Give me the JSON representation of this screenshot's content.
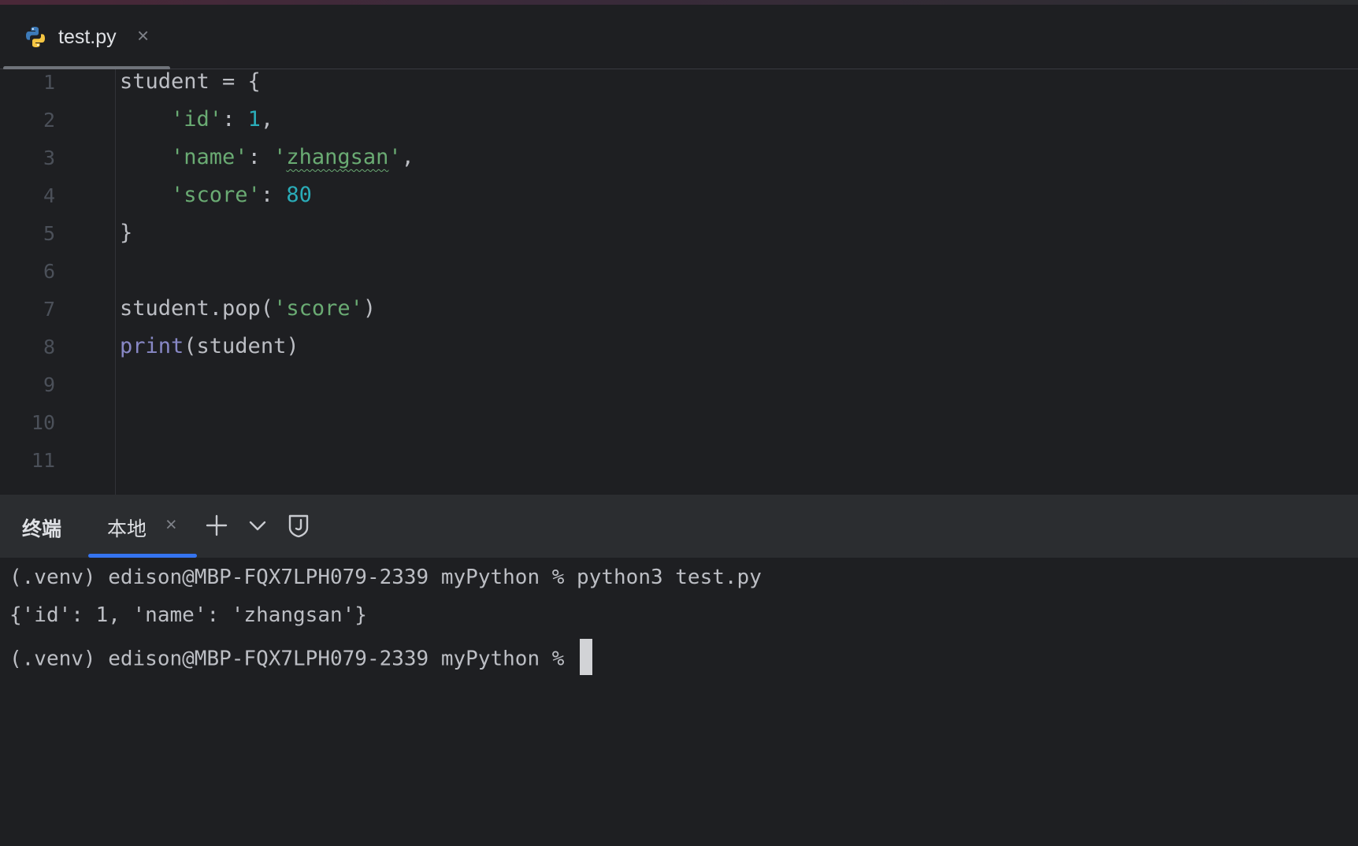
{
  "tab": {
    "filename": "test.py",
    "close": "×"
  },
  "editor": {
    "line_numbers": [
      "1",
      "2",
      "3",
      "4",
      "5",
      "6",
      "7",
      "8",
      "9",
      "10",
      "11"
    ],
    "code": {
      "l1": "student = {",
      "l2_key": "'id'",
      "l2_sep": ": ",
      "l2_val": "1",
      "l2_end": ",",
      "l3_key": "'name'",
      "l3_sep": ": ",
      "l3_q1": "'",
      "l3_val": "zhangsan",
      "l3_q2": "'",
      "l3_end": ",",
      "l4_key": "'score'",
      "l4_sep": ": ",
      "l4_val": "80",
      "l5": "}",
      "l7_a": "student.pop(",
      "l7_str": "'score'",
      "l7_b": ")",
      "l8_fn": "print",
      "l8_rest": "(student)"
    }
  },
  "terminal": {
    "title": "终端",
    "tab_label": "本地",
    "tab_close": "×",
    "lines": [
      "(.venv) edison@MBP-FQX7LPH079-2339 myPython % python3 test.py",
      "{'id': 1, 'name': 'zhangsan'}",
      "(.venv) edison@MBP-FQX7LPH079-2339 myPython % "
    ]
  },
  "colors": {
    "accent": "#3574f0",
    "string": "#6aab73",
    "number": "#2aacb8",
    "builtin": "#8888c6"
  },
  "icons": [
    "python-file-icon",
    "close-icon",
    "plus-icon",
    "chevron-down-icon",
    "shield-icon"
  ]
}
